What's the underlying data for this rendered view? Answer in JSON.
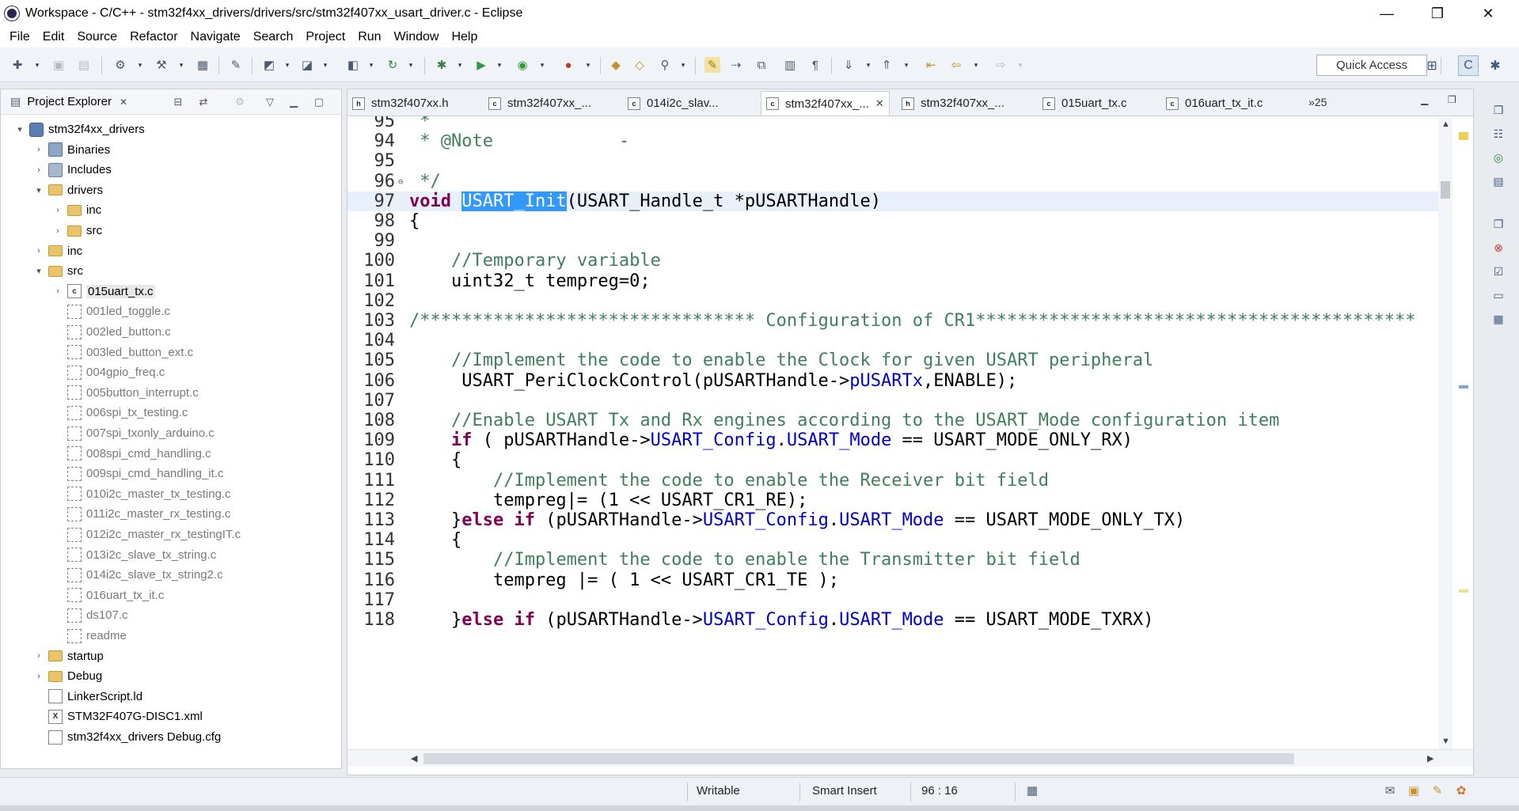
{
  "window": {
    "title": "Workspace - C/C++ - stm32f4xx_drivers/drivers/src/stm32f407xx_usart_driver.c - Eclipse",
    "minimize": "—",
    "maximize": "❐",
    "close": "✕"
  },
  "menu": [
    "File",
    "Edit",
    "Source",
    "Refactor",
    "Navigate",
    "Search",
    "Project",
    "Run",
    "Window",
    "Help"
  ],
  "toolbar": {
    "quick_access": "Quick Access"
  },
  "explorer": {
    "title": "Project Explorer",
    "close": "✕",
    "tree": [
      {
        "label": "stm32f4xx_drivers",
        "twisty": "▾",
        "icon": "project-icon"
      },
      {
        "label": "Binaries",
        "twisty": "›",
        "icon": "binaries-icon"
      },
      {
        "label": "Includes",
        "twisty": "›",
        "icon": "includes-icon"
      },
      {
        "label": "drivers",
        "twisty": "▾",
        "icon": "folder-icon"
      },
      {
        "label": "inc",
        "twisty": "›",
        "icon": "folder-icon"
      },
      {
        "label": "src",
        "twisty": "›",
        "icon": "folder-icon"
      },
      {
        "label": "inc",
        "twisty": "›",
        "icon": "folder-icon"
      },
      {
        "label": "src",
        "twisty": "▾",
        "icon": "folder-icon"
      },
      {
        "label": "015uart_tx.c",
        "twisty": "›",
        "icon": "c-file-icon"
      },
      {
        "label": "001led_toggle.c",
        "twisty": "",
        "icon": "excluded-file-icon"
      },
      {
        "label": "002led_button.c",
        "twisty": "",
        "icon": "excluded-file-icon"
      },
      {
        "label": "003led_button_ext.c",
        "twisty": "",
        "icon": "excluded-file-icon"
      },
      {
        "label": "004gpio_freq.c",
        "twisty": "",
        "icon": "excluded-file-icon"
      },
      {
        "label": "005button_interrupt.c",
        "twisty": "",
        "icon": "excluded-file-icon"
      },
      {
        "label": "006spi_tx_testing.c",
        "twisty": "",
        "icon": "excluded-file-icon"
      },
      {
        "label": "007spi_txonly_arduino.c",
        "twisty": "",
        "icon": "excluded-file-icon"
      },
      {
        "label": "008spi_cmd_handling.c",
        "twisty": "",
        "icon": "excluded-file-icon"
      },
      {
        "label": "009spi_cmd_handling_it.c",
        "twisty": "",
        "icon": "excluded-file-icon"
      },
      {
        "label": "010i2c_master_tx_testing.c",
        "twisty": "",
        "icon": "excluded-file-icon"
      },
      {
        "label": "011i2c_master_rx_testing.c",
        "twisty": "",
        "icon": "excluded-file-icon"
      },
      {
        "label": "012i2c_master_rx_testingIT.c",
        "twisty": "",
        "icon": "excluded-file-icon"
      },
      {
        "label": "013i2c_slave_tx_string.c",
        "twisty": "",
        "icon": "excluded-file-icon"
      },
      {
        "label": "014i2c_slave_tx_string2.c",
        "twisty": "",
        "icon": "excluded-file-icon"
      },
      {
        "label": "016uart_tx_it.c",
        "twisty": "",
        "icon": "excluded-file-icon"
      },
      {
        "label": "ds107.c",
        "twisty": "",
        "icon": "excluded-file-icon"
      },
      {
        "label": "readme",
        "twisty": "",
        "icon": "excluded-file-icon"
      },
      {
        "label": "startup",
        "twisty": "›",
        "icon": "folder-icon"
      },
      {
        "label": "Debug",
        "twisty": "›",
        "icon": "folder-icon"
      },
      {
        "label": "LinkerScript.ld",
        "twisty": "",
        "icon": "file-icon"
      },
      {
        "label": "STM32F407G-DISC1.xml",
        "twisty": "",
        "icon": "xml-file-icon"
      },
      {
        "label": "stm32f4xx_drivers Debug.cfg",
        "twisty": "",
        "icon": "file-icon"
      }
    ]
  },
  "editor": {
    "tabs": [
      {
        "label": "stm32f407xx.h",
        "type": "h"
      },
      {
        "label": "stm32f407xx_...",
        "type": "c"
      },
      {
        "label": "014i2c_slav...",
        "type": "c"
      },
      {
        "label": "stm32f407xx_...",
        "type": "c",
        "active": true
      },
      {
        "label": "stm32f407xx_...",
        "type": "h"
      },
      {
        "label": "015uart_tx.c",
        "type": "c"
      },
      {
        "label": "016uart_tx_it.c",
        "type": "c"
      }
    ],
    "tab_close": "✕",
    "overflow": "»25",
    "lines": [
      {
        "n": "95",
        "parts": [
          [
            "cm",
            " *"
          ]
        ]
      },
      {
        "n": "94",
        "parts": [
          [
            "cm",
            " * @Note            -"
          ]
        ]
      },
      {
        "n": "95",
        "parts": [
          [
            "cm",
            ""
          ]
        ]
      },
      {
        "n": "96",
        "parts": [
          [
            "cm",
            " */"
          ]
        ],
        "fold": "⊖"
      },
      {
        "n": "97",
        "parts": [
          [
            "kw",
            "void"
          ],
          [
            "",
            " "
          ],
          [
            "sel",
            "USART_Init"
          ],
          [
            "",
            "(USART_Handle_t *pUSARTHandle)"
          ]
        ],
        "current": true
      },
      {
        "n": "98",
        "parts": [
          [
            "",
            "{"
          ]
        ]
      },
      {
        "n": "99",
        "parts": [
          [
            "",
            ""
          ]
        ]
      },
      {
        "n": "100",
        "parts": [
          [
            "",
            "    "
          ],
          [
            "cm",
            "//Temporary variable"
          ]
        ]
      },
      {
        "n": "101",
        "parts": [
          [
            "",
            "    uint32_t tempreg=0;"
          ]
        ]
      },
      {
        "n": "102",
        "parts": [
          [
            "",
            ""
          ]
        ]
      },
      {
        "n": "103",
        "parts": [
          [
            "cm",
            "/******************************** Configuration of CR1******************************************"
          ]
        ]
      },
      {
        "n": "104",
        "parts": [
          [
            "",
            ""
          ]
        ]
      },
      {
        "n": "105",
        "parts": [
          [
            "",
            "    "
          ],
          [
            "cm",
            "//Implement the code to enable the Clock for given USART peripheral"
          ]
        ]
      },
      {
        "n": "106",
        "parts": [
          [
            "",
            "     USART_PeriClockControl(pUSARTHandle->"
          ],
          [
            "fld",
            "pUSARTx"
          ],
          [
            "",
            ",ENABLE);"
          ]
        ]
      },
      {
        "n": "107",
        "parts": [
          [
            "",
            ""
          ]
        ]
      },
      {
        "n": "108",
        "parts": [
          [
            "",
            "    "
          ],
          [
            "cm",
            "//Enable USART Tx and Rx engines according to the USART_Mode configuration item"
          ]
        ]
      },
      {
        "n": "109",
        "parts": [
          [
            "",
            "    "
          ],
          [
            "kw",
            "if"
          ],
          [
            "",
            " ( pUSARTHandle->"
          ],
          [
            "fld",
            "USART_Config"
          ],
          [
            "",
            "."
          ],
          [
            "fld",
            "USART_Mode"
          ],
          [
            "",
            " == USART_MODE_ONLY_RX)"
          ]
        ]
      },
      {
        "n": "110",
        "parts": [
          [
            "",
            "    {"
          ]
        ]
      },
      {
        "n": "111",
        "parts": [
          [
            "",
            "        "
          ],
          [
            "cm",
            "//Implement the code to enable the Receiver bit field"
          ]
        ]
      },
      {
        "n": "112",
        "parts": [
          [
            "",
            "        tempreg|= (1 << USART_CR1_RE);"
          ]
        ]
      },
      {
        "n": "113",
        "parts": [
          [
            "",
            "    }"
          ],
          [
            "kw",
            "else"
          ],
          [
            "",
            " "
          ],
          [
            "kw",
            "if"
          ],
          [
            "",
            " (pUSARTHandle->"
          ],
          [
            "fld",
            "USART_Config"
          ],
          [
            "",
            "."
          ],
          [
            "fld",
            "USART_Mode"
          ],
          [
            "",
            " == USART_MODE_ONLY_TX)"
          ]
        ]
      },
      {
        "n": "114",
        "parts": [
          [
            "",
            "    {"
          ]
        ]
      },
      {
        "n": "115",
        "parts": [
          [
            "",
            "        "
          ],
          [
            "cm",
            "//Implement the code to enable the Transmitter bit field"
          ]
        ]
      },
      {
        "n": "116",
        "parts": [
          [
            "",
            "        tempreg |= ( 1 << USART_CR1_TE );"
          ]
        ]
      },
      {
        "n": "117",
        "parts": [
          [
            "",
            ""
          ]
        ]
      },
      {
        "n": "118",
        "parts": [
          [
            "",
            "    }"
          ],
          [
            "kw",
            "else"
          ],
          [
            "",
            " "
          ],
          [
            "kw",
            "if"
          ],
          [
            "",
            " (pUSARTHandle->"
          ],
          [
            "fld",
            "USART_Config"
          ],
          [
            "",
            "."
          ],
          [
            "fld",
            "USART_Mode"
          ],
          [
            "",
            " == USART_MODE_TXRX)"
          ]
        ]
      }
    ]
  },
  "status": {
    "writable": "Writable",
    "insert_mode": "Smart Insert",
    "cursor_pos": "96 : 16"
  }
}
